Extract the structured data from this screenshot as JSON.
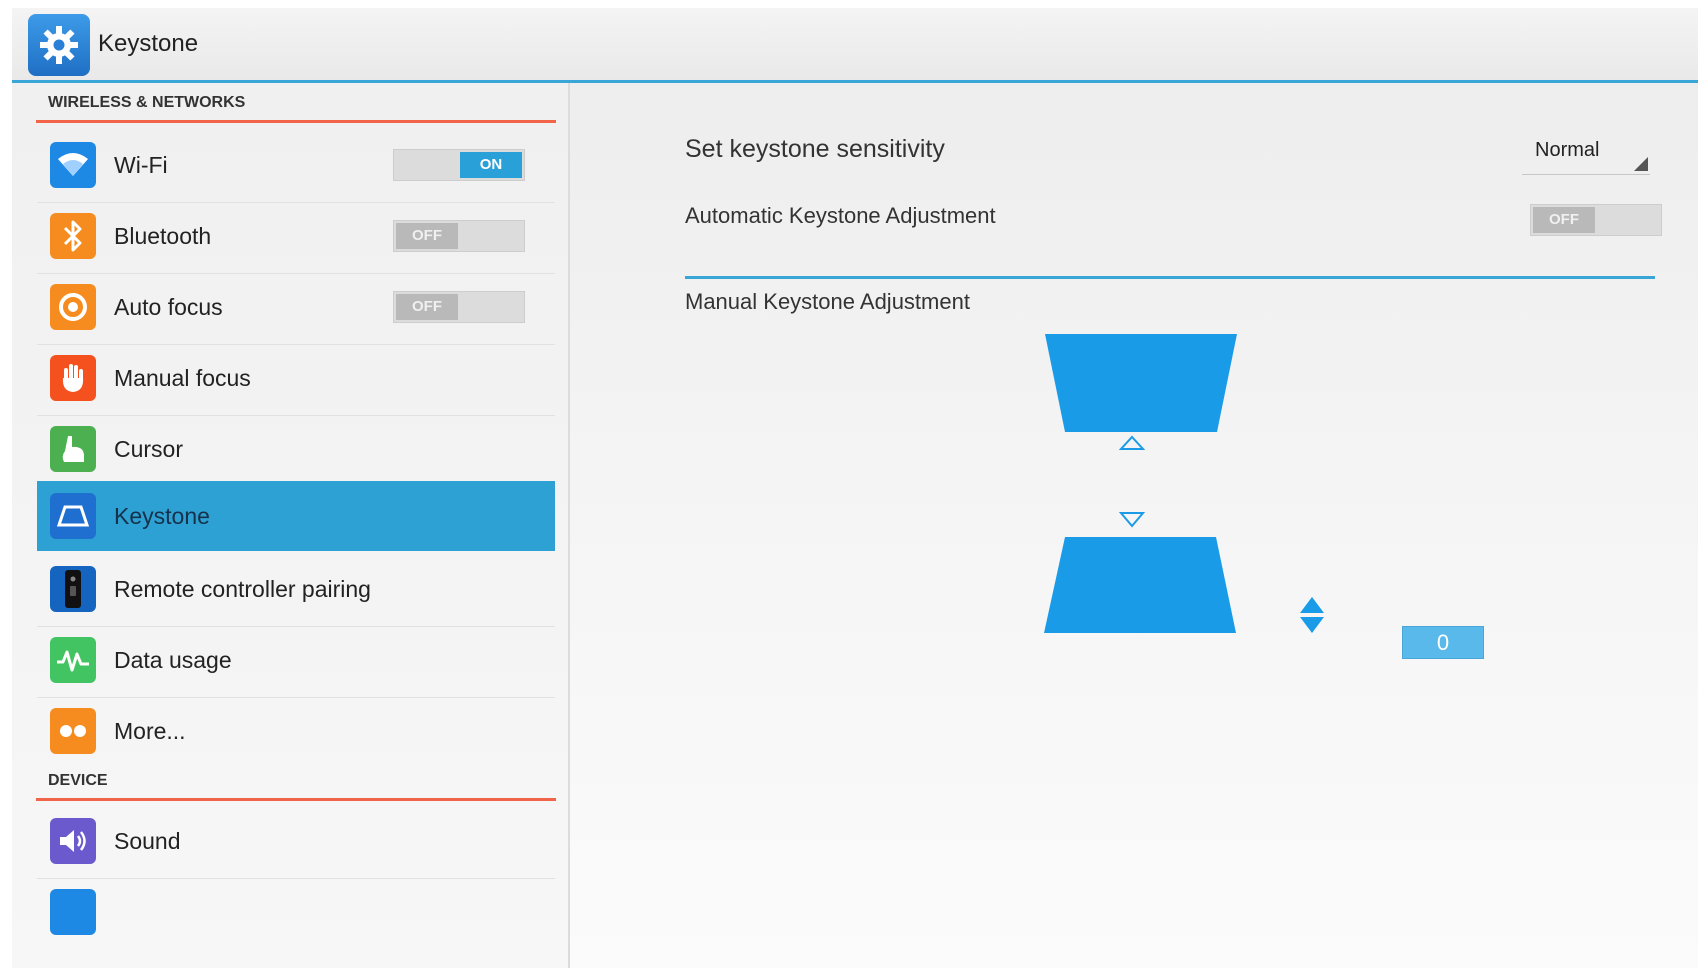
{
  "app": {
    "title": "Keystone",
    "icon": "gear-icon"
  },
  "sidebar": {
    "sections": [
      {
        "header": "WIRELESS & NETWORKS"
      },
      {
        "header": "DEVICE"
      }
    ],
    "items": [
      {
        "label": "Wi-Fi",
        "icon": "wifi-icon",
        "icon_color": "#1e88e5",
        "toggle": "ON"
      },
      {
        "label": "Bluetooth",
        "icon": "bluetooth-icon",
        "icon_color": "#f68b1f",
        "toggle": "OFF"
      },
      {
        "label": "Auto focus",
        "icon": "auto-focus-icon",
        "icon_color": "#f68b1f",
        "toggle": "OFF"
      },
      {
        "label": "Manual focus",
        "icon": "hand-icon",
        "icon_color": "#f4511e"
      },
      {
        "label": "Cursor",
        "icon": "cursor-icon",
        "icon_color": "#4caf50"
      },
      {
        "label": "Keystone",
        "icon": "keystone-icon",
        "icon_color": "#1e88e5",
        "selected": true
      },
      {
        "label": "Remote controller pairing",
        "icon": "remote-icon",
        "icon_color": "#1565c0"
      },
      {
        "label": "Data usage",
        "icon": "data-usage-icon",
        "icon_color": "#43c463"
      },
      {
        "label": "More...",
        "icon": "more-icon",
        "icon_color": "#f68b1f"
      },
      {
        "label": "Sound",
        "icon": "sound-icon",
        "icon_color": "#6a5acd"
      }
    ]
  },
  "main": {
    "sensitivity": {
      "label": "Set keystone sensitivity",
      "value": "Normal"
    },
    "auto_adjust": {
      "label": "Automatic Keystone Adjustment",
      "toggle": "OFF"
    },
    "manual": {
      "label": "Manual Keystone Adjustment",
      "value": "0"
    }
  },
  "colors": {
    "accent": "#2ea1d4",
    "keystone_shape": "#1a9be8",
    "section_divider": "#f2644a"
  }
}
